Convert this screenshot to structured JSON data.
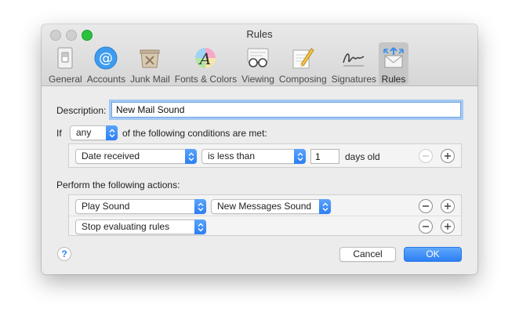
{
  "window": {
    "title": "Rules"
  },
  "toolbar": {
    "items": [
      {
        "label": "General",
        "icon": "general-switch-icon"
      },
      {
        "label": "Accounts",
        "icon": "at-sign-icon"
      },
      {
        "label": "Junk Mail",
        "icon": "junk-bin-icon"
      },
      {
        "label": "Fonts & Colors",
        "icon": "font-color-icon"
      },
      {
        "label": "Viewing",
        "icon": "glasses-icon"
      },
      {
        "label": "Composing",
        "icon": "pencil-paper-icon"
      },
      {
        "label": "Signatures",
        "icon": "signature-icon"
      },
      {
        "label": "Rules",
        "icon": "rules-envelope-icon"
      }
    ],
    "active": "Rules"
  },
  "form": {
    "description_label": "Description:",
    "description_value": "New Mail Sound",
    "if_label": "If",
    "match_mode": "any",
    "conditions_suffix": "of the following conditions are met:",
    "condition": {
      "field": "Date received",
      "operator": "is less than",
      "value": "1",
      "unit": "days old"
    },
    "actions_label": "Perform the following actions:",
    "actions": [
      {
        "action": "Play Sound",
        "target": "New Messages Sound"
      },
      {
        "action": "Stop evaluating rules"
      }
    ]
  },
  "buttons": {
    "help": "?",
    "cancel": "Cancel",
    "ok": "OK"
  },
  "colors": {
    "accent": "#2d7ff5",
    "focus_ring": "#a5c8f2",
    "zoom_button": "#2cc13f"
  }
}
